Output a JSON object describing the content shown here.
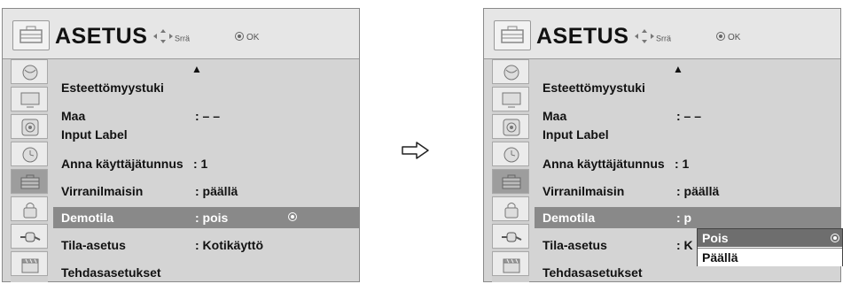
{
  "menu": {
    "title": "ASETUS",
    "nav_hint": "Srrä",
    "ok_hint": "OK",
    "items": [
      {
        "label": "Esteettömyystuki",
        "value": ""
      },
      {
        "label": "Maa",
        "value": ": – –"
      },
      {
        "label": "Input Label",
        "value": ""
      },
      {
        "label": "Anna käyttäjätunnus",
        "value": ": 1"
      },
      {
        "label": "Virranilmaisin",
        "value": ": päällä"
      },
      {
        "label": "Demotila",
        "value": ": pois"
      },
      {
        "label": "Tila-asetus",
        "value": ": Kotikäyttö"
      },
      {
        "label": "Tehdasasetukset",
        "value": ""
      }
    ],
    "right_items": [
      {
        "label": "Esteettömyystuki",
        "value": ""
      },
      {
        "label": "Maa",
        "value": ": – –"
      },
      {
        "label": "Input Label",
        "value": ""
      },
      {
        "label": "Anna käyttäjätunnus",
        "value": ": 1"
      },
      {
        "label": "Virranilmaisin",
        "value": ": päällä"
      },
      {
        "label": "Demotila",
        "value": ": p"
      },
      {
        "label": "Tila-asetus",
        "value": ": K"
      },
      {
        "label": "Tehdasasetukset",
        "value": ""
      }
    ],
    "selected_index": 5,
    "icons": [
      "satellite-dish-icon",
      "monitor-icon",
      "speaker-icon",
      "clock-icon",
      "toolbox-icon",
      "lock-icon",
      "input-plug-icon",
      "clapperboard-icon"
    ],
    "selected_icon_index": 4
  },
  "popup": {
    "options": [
      "Pois",
      "Päällä"
    ],
    "selected": "Pois"
  },
  "colors": {
    "panel_bg": "#d4d4d4",
    "header_bg": "#e6e6e6",
    "highlight_row": "#898989",
    "popup_selected": "#6e6e6e"
  }
}
